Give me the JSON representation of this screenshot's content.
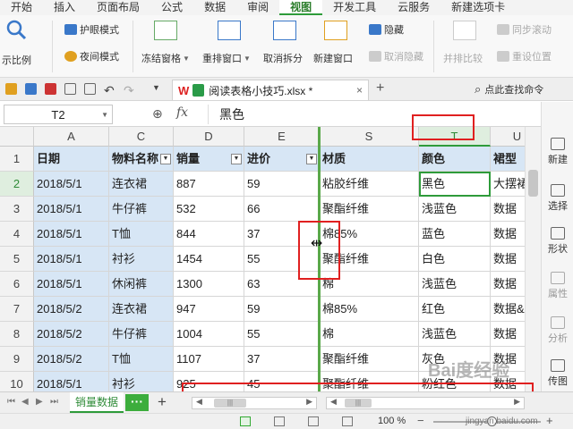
{
  "menu": {
    "tabs": [
      "开始",
      "插入",
      "页面布局",
      "公式",
      "数据",
      "审阅",
      "视图",
      "开发工具",
      "云服务",
      "新建选项卡"
    ],
    "active_index": 6
  },
  "ribbon": {
    "show_scale": "示比例",
    "eye_mode": "护眼模式",
    "night_mode": "夜间模式",
    "freeze_panes": "冻结窗格",
    "arrange_windows": "重排窗口",
    "cancel_split": "取消拆分",
    "new_window": "新建窗口",
    "hide": "隐藏",
    "unhide": "取消隐藏",
    "side_by_side": "并排比较",
    "sync_scroll": "同步滚动",
    "reset_position": "重设位置"
  },
  "docbar": {
    "wps_logo": "W",
    "doc_name": "阅读表格小技巧.xlsx *",
    "close": "×",
    "new_tab": "+",
    "search_hint": "点此查找命令"
  },
  "formula_bar": {
    "name_box": "T2",
    "fx": "fx",
    "value": "黑色"
  },
  "columns": [
    "A",
    "C",
    "D",
    "E",
    "S",
    "T",
    "U"
  ],
  "selected_column": "T",
  "row_numbers": [
    "1",
    "2",
    "3",
    "4",
    "5",
    "6",
    "7",
    "8",
    "9",
    "10"
  ],
  "selected_row": "2",
  "headers": [
    "日期",
    "物料名称",
    "销量",
    "进价",
    "材质",
    "颜色",
    "裙型"
  ],
  "rows": [
    [
      "2018/5/1",
      "连衣裙",
      "887",
      "59",
      "粘胶纤维",
      "黑色",
      "大摆裙"
    ],
    [
      "2018/5/1",
      "牛仔裤",
      "532",
      "66",
      "聚酯纤维",
      "浅蓝色",
      "数据"
    ],
    [
      "2018/5/1",
      "T恤",
      "844",
      "37",
      "棉85%",
      "蓝色",
      "数据"
    ],
    [
      "2018/5/1",
      "衬衫",
      "1454",
      "55",
      "聚酯纤维",
      "白色",
      "数据"
    ],
    [
      "2018/5/1",
      "休闲裤",
      "1300",
      "63",
      "棉",
      "浅蓝色",
      "数据"
    ],
    [
      "2018/5/2",
      "连衣裙",
      "947",
      "59",
      "棉85%",
      "红色",
      "数据&"
    ],
    [
      "2018/5/2",
      "牛仔裤",
      "1004",
      "55",
      "棉",
      "浅蓝色",
      "数据"
    ],
    [
      "2018/5/2",
      "T恤",
      "1107",
      "37",
      "聚酯纤维",
      "灰色",
      "数据"
    ],
    [
      "2018/5/1",
      "衬衫",
      "925",
      "45",
      "聚酯纤维",
      "粉红色",
      "数据"
    ]
  ],
  "right_panel": {
    "items": [
      "新建",
      "选择",
      "形状",
      "属性",
      "分析",
      "传图"
    ]
  },
  "sheet_bar": {
    "sheet_name": "销量数据",
    "more": "···",
    "add": "+"
  },
  "status_bar": {
    "zoom": "100 %"
  },
  "watermark": {
    "text": "Bai度经验",
    "url": "jingyan.baidu.com"
  },
  "colors": {
    "accent_green": "#2e9b3a",
    "band_blue": "#d7e6f5",
    "annotation_red": "#e02020"
  }
}
